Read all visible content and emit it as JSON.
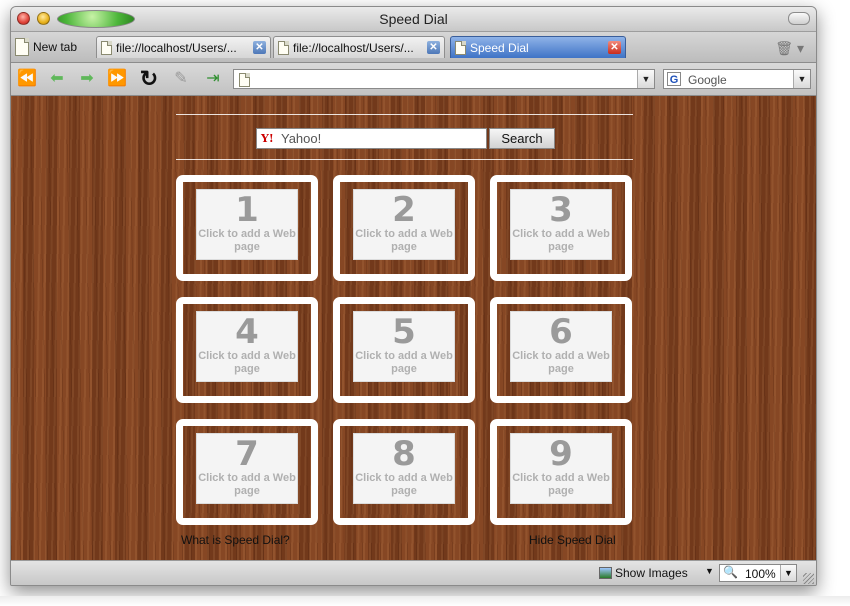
{
  "window": {
    "title": "Speed Dial"
  },
  "tabs": {
    "new_tab_label": "New tab",
    "items": [
      {
        "label": "file://localhost/Users/...",
        "active": false
      },
      {
        "label": "file://localhost/Users/...",
        "active": false
      },
      {
        "label": "Speed Dial",
        "active": true
      }
    ]
  },
  "toolbar": {
    "address_value": "",
    "search_engine": "Google"
  },
  "page": {
    "search_query": "Yahoo!",
    "search_button": "Search",
    "dials": [
      {
        "number": "1",
        "hint": "Click to add a Web page"
      },
      {
        "number": "2",
        "hint": "Click to add a Web page"
      },
      {
        "number": "3",
        "hint": "Click to add a Web page"
      },
      {
        "number": "4",
        "hint": "Click to add a Web page"
      },
      {
        "number": "5",
        "hint": "Click to add a Web page"
      },
      {
        "number": "6",
        "hint": "Click to add a Web page"
      },
      {
        "number": "7",
        "hint": "Click to add a Web page"
      },
      {
        "number": "8",
        "hint": "Click to add a Web page"
      },
      {
        "number": "9",
        "hint": "Click to add a Web page"
      }
    ],
    "what_is_link": "What is Speed Dial?",
    "hide_link": "Hide Speed Dial"
  },
  "status": {
    "show_images": "Show Images",
    "zoom": "100%"
  },
  "colors": {
    "wood": "#7a3f1f",
    "active_tab": "#3f73c6",
    "dial_frame": "#ffffff"
  }
}
